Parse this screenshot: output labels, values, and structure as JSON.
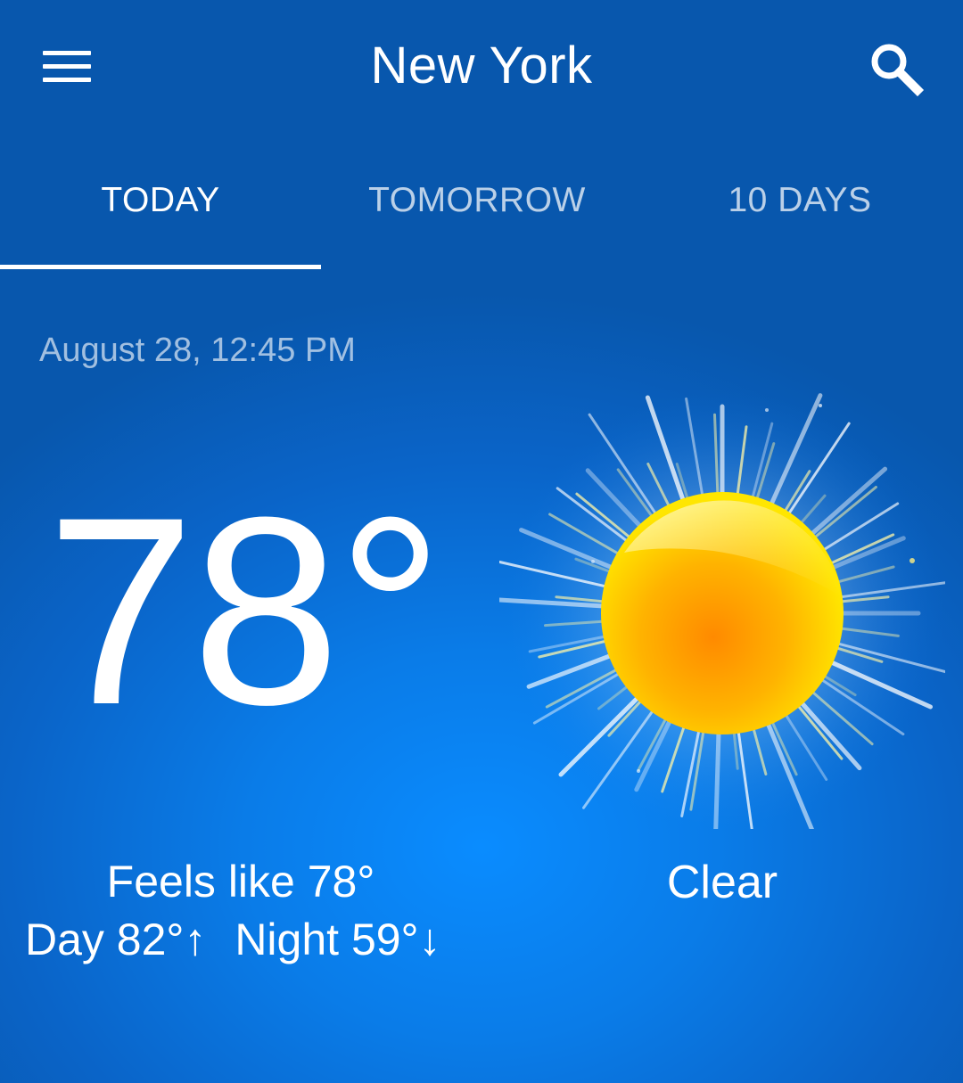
{
  "header": {
    "city": "New York",
    "menu_icon": "hamburger-menu-icon",
    "search_icon": "search-icon"
  },
  "tabs": [
    {
      "label": "TODAY",
      "selected": true
    },
    {
      "label": "TOMORROW",
      "selected": false
    },
    {
      "label": "10 DAYS",
      "selected": false
    }
  ],
  "weather": {
    "datetime": "August 28, 12:45 PM",
    "temperature": "78°",
    "feels_like": "Feels like 78°",
    "day": "Day 82°↑",
    "night": "Night 59°↓",
    "condition": "Clear",
    "condition_icon": "sun-icon"
  },
  "colors": {
    "background": "#0a7ce8",
    "text": "#ffffff",
    "sun_core": "#ff8c00",
    "sun_rim": "#ffe600"
  }
}
